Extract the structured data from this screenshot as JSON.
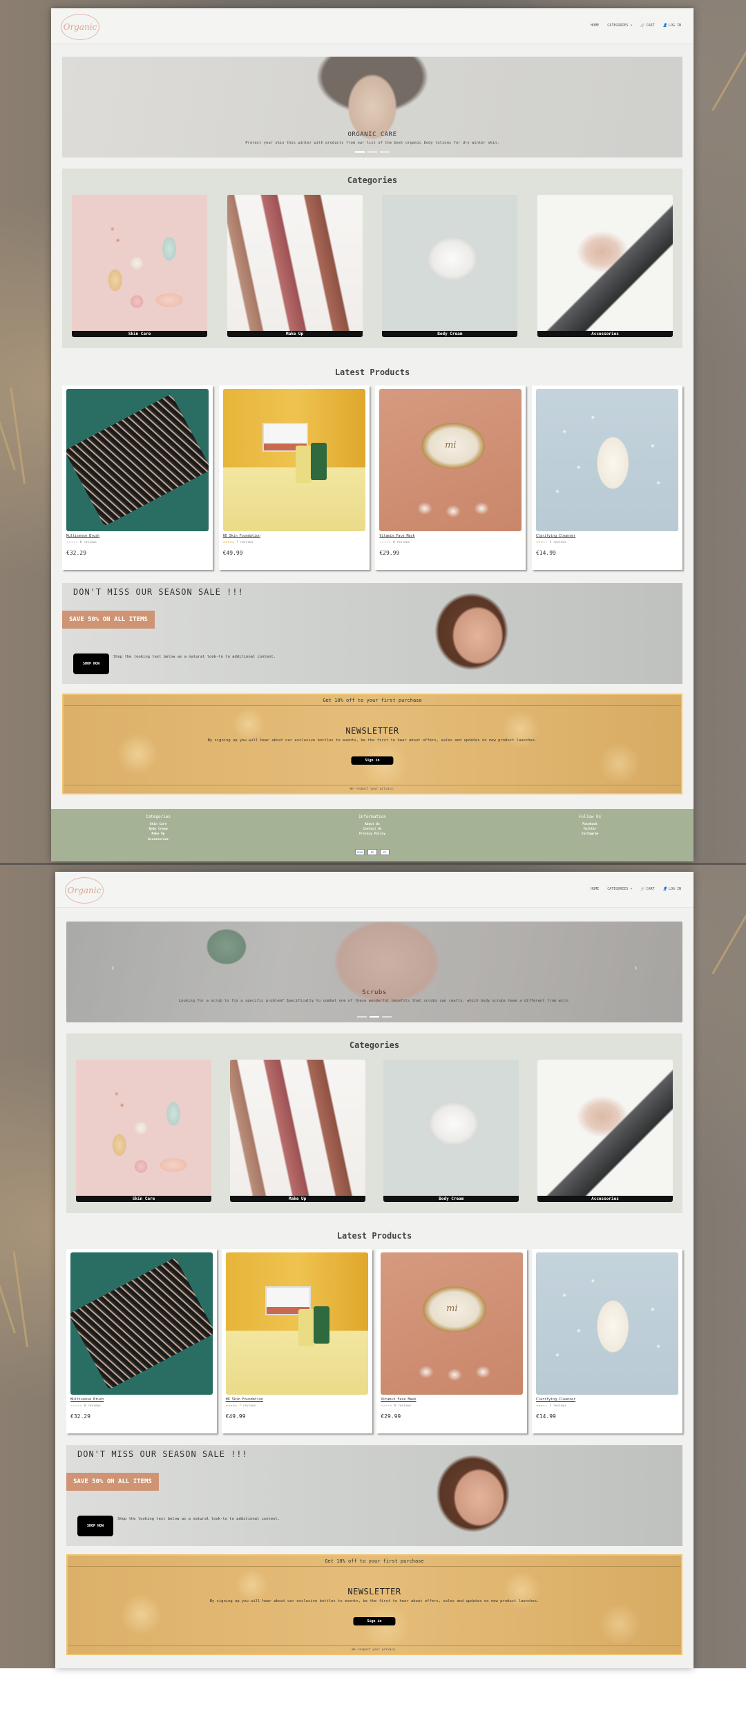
{
  "logo": "Organic",
  "nav": {
    "home": "HOME",
    "categories": "CATEGORIES ▾",
    "cart": "CART",
    "login": "LOG IN"
  },
  "hero_slides": [
    {
      "title": "ORGANIC CARE",
      "text": "Protect your skin this winter with products from our list of the best organic body lotions for dry winter skin."
    },
    {
      "title": "Scrubs",
      "text": "Looking for a scrub to fix a specific problem? Specifically to combat one of these wonderful benefits that scrubs can really, which body scrubs have a different from with."
    }
  ],
  "categories": {
    "title": "Categories",
    "items": [
      {
        "label": "Skin Care"
      },
      {
        "label": "Make Up"
      },
      {
        "label": "Body Cream"
      },
      {
        "label": "Accessories"
      }
    ]
  },
  "products": {
    "title": "Latest Products",
    "items": [
      {
        "name": "Multisense Brush",
        "rating": 0,
        "reviews": "0 reviews",
        "price": "€32.29"
      },
      {
        "name": "HD Skin Foundation",
        "rating": 5,
        "reviews": "7 reviews",
        "price": "€49.99"
      },
      {
        "name": "Vitamin Face Mask",
        "rating": 0,
        "reviews": "0 reviews",
        "price": "€29.99"
      },
      {
        "name": "Clarifying Cleanser",
        "rating": 3,
        "reviews": "1 reviews",
        "price": "€14.99"
      }
    ]
  },
  "sale": {
    "title": "DON'T MISS OUR SEASON SALE !!!",
    "badge": "SAVE 50% ON ALL ITEMS",
    "text": "Shop the looking text below as a natural look-to to additional content.",
    "button": "SHOP NOW"
  },
  "newsletter": {
    "top": "Get 10% off to your first purchase",
    "title": "NEWSLETTER",
    "text": "By signing up you will hear about our exclusive bottles to events, be the first to hear about offers, sales and updates on new product launches.",
    "button": "Sign in",
    "privacy": "We respect your privacy."
  },
  "footer": {
    "columns": [
      {
        "title": "Categories",
        "links": [
          "Skin Care",
          "Body Cream",
          "Make Up",
          "Accessories"
        ]
      },
      {
        "title": "Information",
        "links": [
          "About Us",
          "Contact Us",
          "Privacy Policy"
        ]
      },
      {
        "title": "Follow Us",
        "links": [
          "Facebook",
          "Twitter",
          "Instagram"
        ]
      }
    ],
    "payments": [
      "VISA",
      "MC",
      "PP"
    ]
  },
  "colors": {
    "footer_bg": "#a6b295",
    "sale_badge": "#cf9473",
    "newsletter_bg": "#e0b46e",
    "category_bg": "#dfe1db"
  }
}
